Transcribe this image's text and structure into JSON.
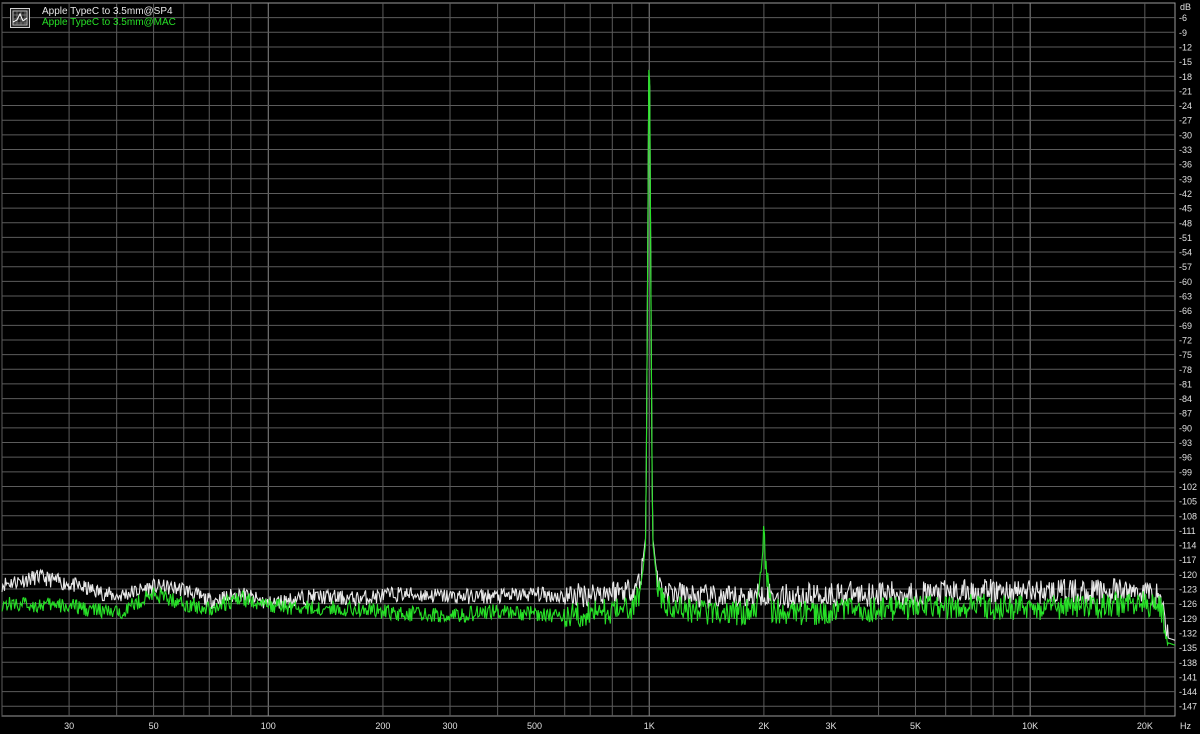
{
  "chart_data": {
    "type": "line",
    "title": "",
    "xlabel": "",
    "ylabel": "",
    "y_unit": "dB",
    "x_unit": "Hz",
    "x_scale": "log",
    "xlim": [
      20,
      24000
    ],
    "ylim": [
      -149,
      -3
    ],
    "grid": true,
    "legend_position": "top-left",
    "x_tick_labels": [
      {
        "value": 30,
        "label": "30"
      },
      {
        "value": 50,
        "label": "50"
      },
      {
        "value": 100,
        "label": "100"
      },
      {
        "value": 200,
        "label": "200"
      },
      {
        "value": 300,
        "label": "300"
      },
      {
        "value": 500,
        "label": "500"
      },
      {
        "value": 1000,
        "label": "1K"
      },
      {
        "value": 2000,
        "label": "2K"
      },
      {
        "value": 3000,
        "label": "3K"
      },
      {
        "value": 5000,
        "label": "5K"
      },
      {
        "value": 10000,
        "label": "10K"
      },
      {
        "value": 20000,
        "label": "20K"
      }
    ],
    "y_ticks": [
      -6,
      -9,
      -12,
      -15,
      -18,
      -21,
      -24,
      -27,
      -30,
      -33,
      -36,
      -39,
      -42,
      -45,
      -48,
      -51,
      -54,
      -57,
      -60,
      -63,
      -66,
      -69,
      -72,
      -75,
      -78,
      -81,
      -84,
      -87,
      -90,
      -93,
      -96,
      -99,
      -102,
      -105,
      -108,
      -111,
      -114,
      -117,
      -120,
      -123,
      -126,
      -129,
      -132,
      -135,
      -138,
      -141,
      -144,
      -147
    ],
    "series": [
      {
        "name": "Apple TypeC to 3.5mm@SP4",
        "color": "#e8e8e8",
        "points": [
          [
            20,
            -122.0
          ],
          [
            25,
            -120.5
          ],
          [
            30,
            -122.0
          ],
          [
            40,
            -124.5
          ],
          [
            50,
            -122.5
          ],
          [
            60,
            -123.0
          ],
          [
            70,
            -125.5
          ],
          [
            85,
            -124.0
          ],
          [
            100,
            -126.0
          ],
          [
            130,
            -124.5
          ],
          [
            170,
            -125.0
          ],
          [
            220,
            -124.0
          ],
          [
            300,
            -124.5
          ],
          [
            400,
            -124.5
          ],
          [
            500,
            -124.0
          ],
          [
            600,
            -124.5
          ],
          [
            700,
            -124.0
          ],
          [
            800,
            -123.5
          ],
          [
            900,
            -123.0
          ],
          [
            950,
            -121.0
          ],
          [
            980,
            -112.0
          ],
          [
            1000,
            -5.5
          ],
          [
            1020,
            -112.0
          ],
          [
            1050,
            -121.0
          ],
          [
            1100,
            -123.5
          ],
          [
            1300,
            -124.5
          ],
          [
            1600,
            -125.0
          ],
          [
            1900,
            -124.5
          ],
          [
            2000,
            -123.5
          ],
          [
            2100,
            -124.5
          ],
          [
            2500,
            -124.5
          ],
          [
            3000,
            -124.0
          ],
          [
            4000,
            -124.0
          ],
          [
            5000,
            -124.0
          ],
          [
            7000,
            -123.5
          ],
          [
            10000,
            -123.5
          ],
          [
            15000,
            -123.5
          ],
          [
            20000,
            -123.5
          ],
          [
            22000,
            -124.5
          ],
          [
            23000,
            -133.0
          ],
          [
            24000,
            -133.5
          ]
        ]
      },
      {
        "name": "Apple TypeC to 3.5mm@MAC",
        "color": "#27e027",
        "points": [
          [
            20,
            -126.0
          ],
          [
            30,
            -126.5
          ],
          [
            40,
            -128.0
          ],
          [
            50,
            -124.0
          ],
          [
            60,
            -126.0
          ],
          [
            70,
            -127.0
          ],
          [
            85,
            -125.0
          ],
          [
            100,
            -126.5
          ],
          [
            130,
            -127.0
          ],
          [
            170,
            -127.0
          ],
          [
            220,
            -128.0
          ],
          [
            300,
            -128.5
          ],
          [
            400,
            -127.5
          ],
          [
            500,
            -128.0
          ],
          [
            600,
            -128.5
          ],
          [
            700,
            -128.0
          ],
          [
            800,
            -127.5
          ],
          [
            900,
            -127.0
          ],
          [
            950,
            -124.0
          ],
          [
            980,
            -113.0
          ],
          [
            1000,
            -4.0
          ],
          [
            1020,
            -113.0
          ],
          [
            1050,
            -122.0
          ],
          [
            1100,
            -126.5
          ],
          [
            1300,
            -127.5
          ],
          [
            1600,
            -128.0
          ],
          [
            1900,
            -127.5
          ],
          [
            1980,
            -118.0
          ],
          [
            2000,
            -108.5
          ],
          [
            2020,
            -118.0
          ],
          [
            2100,
            -127.5
          ],
          [
            2500,
            -128.0
          ],
          [
            3000,
            -127.5
          ],
          [
            4000,
            -127.0
          ],
          [
            5000,
            -127.0
          ],
          [
            7000,
            -126.5
          ],
          [
            10000,
            -127.0
          ],
          [
            15000,
            -126.5
          ],
          [
            20000,
            -126.0
          ],
          [
            22000,
            -127.0
          ],
          [
            23000,
            -134.0
          ],
          [
            24000,
            -134.5
          ]
        ]
      }
    ]
  },
  "legend": {
    "icon": "graph-icon",
    "items": [
      {
        "label": "Apple TypeC to 3.5mm@SP4",
        "color": "#e8e8e8"
      },
      {
        "label": "Apple TypeC to 3.5mm@MAC",
        "color": "#27e027"
      }
    ]
  }
}
